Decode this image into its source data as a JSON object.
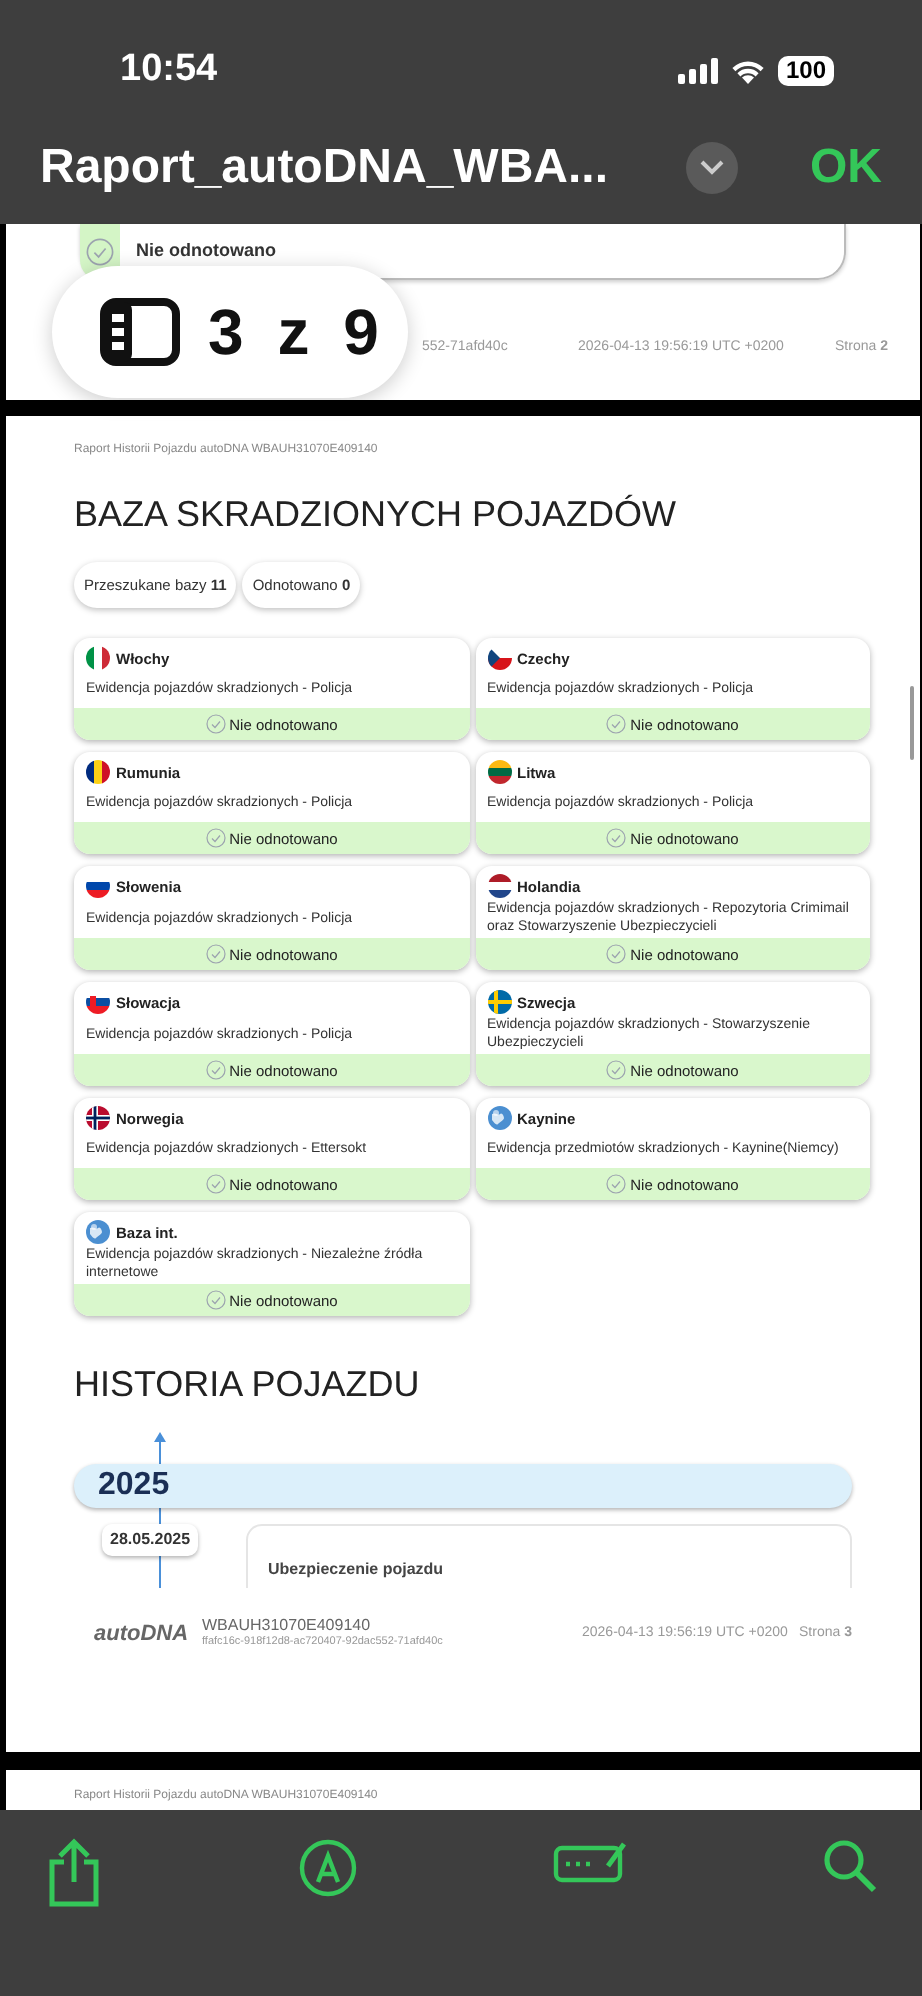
{
  "status_bar": {
    "time": "10:54",
    "battery": "100"
  },
  "title_bar": {
    "title": "Raport_autoDNA_WBA...",
    "done": "OK"
  },
  "page_indicator": {
    "text": "3 z 9"
  },
  "page_prev": {
    "card_status": "Nie odnotowano",
    "hash": "552-71afd40c",
    "timestamp": "2026-04-13 19:56:19 UTC +0200",
    "page": "Strona **2**"
  },
  "page_current": {
    "header": "Raport Historii Pojazdu autoDNA WBAUH31070E409140",
    "title": "BAZA SKRADZIONYCH POJAZDÓW",
    "chips": [
      "Przeszukane bazy **11**",
      "Odnotowano **0**"
    ],
    "databases": [
      {
        "kind": "flag",
        "name": "Włochy",
        "description": "Ewidencja pojazdów skradzionych - Policja",
        "status": "Nie odnotowano"
      },
      {
        "kind": "flag",
        "name": "Czechy",
        "description": "Ewidencja pojazdów skradzionych - Policja",
        "status": "Nie odnotowano"
      },
      {
        "kind": "flag",
        "name": "Rumunia",
        "description": "Ewidencja pojazdów skradzionych - Policja",
        "status": "Nie odnotowano"
      },
      {
        "kind": "flag",
        "name": "Litwa",
        "description": "Ewidencja pojazdów skradzionych - Policja",
        "status": "Nie odnotowano"
      },
      {
        "kind": "flag",
        "name": "Słowenia",
        "description": "Ewidencja pojazdów skradzionych - Policja",
        "status": "Nie odnotowano"
      },
      {
        "kind": "flag",
        "name": "Holandia",
        "description": "Ewidencja pojazdów skradzionych - Repozytoria Crimimail oraz Stowarzyszenie Ubezpieczycieli",
        "status": "Nie odnotowano"
      },
      {
        "kind": "flag",
        "name": "Słowacja",
        "description": "Ewidencja pojazdów skradzionych - Policja",
        "status": "Nie odnotowano"
      },
      {
        "kind": "flag",
        "name": "Szwecja",
        "description": "Ewidencja pojazdów skradzionych - Stowarzyszenie Ubezpieczycieli",
        "status": "Nie odnotowano"
      },
      {
        "kind": "flag",
        "name": "Norwegia",
        "description": "Ewidencja pojazdów skradzionych - Ettersokt",
        "status": "Nie odnotowano"
      },
      {
        "kind": "globe",
        "name": "Kaynine",
        "description": "Ewidencja przedmiotów skradzionych - Kaynine(Niemcy)",
        "status": "Nie odnotowano"
      },
      {
        "kind": "globe",
        "name": "Baza int.",
        "description": "Ewidencja pojazdów skradzionych - Niezależne źródła internetowe",
        "status": "Nie odnotowano"
      }
    ],
    "history_title": "HISTORIA POJAZDU",
    "year": "2025",
    "date": "28.05.2025",
    "event": "Ubezpieczenie pojazdu",
    "footer": {
      "logo": "autoDNA",
      "vin": "WBAUH31070E409140",
      "hash": "ffafc16c-918f12d8-ac720407-92dac552-71afd40c",
      "timestamp": "2026-04-13 19:56:19 UTC +0200",
      "page": "Strona **3**"
    }
  },
  "page_next": {
    "header": "Raport Historii Pojazdu autoDNA WBAUH31070E409140"
  }
}
